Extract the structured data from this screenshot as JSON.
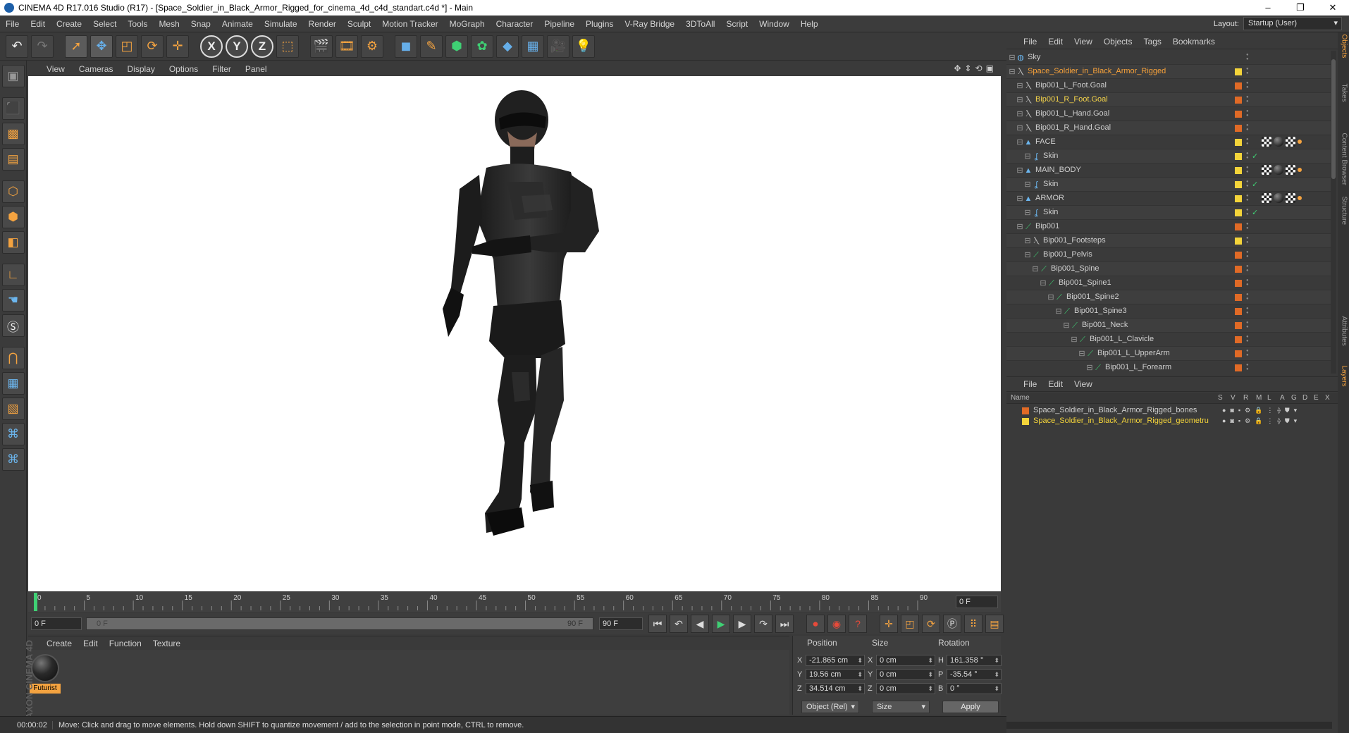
{
  "window": {
    "title": "CINEMA 4D R17.016 Studio (R17) - [Space_Soldier_in_Black_Armor_Rigged_for_cinema_4d_c4d_standart.c4d *] - Main",
    "controls": [
      "–",
      "❐",
      "✕"
    ]
  },
  "menubar": {
    "items": [
      "File",
      "Edit",
      "Create",
      "Select",
      "Tools",
      "Mesh",
      "Snap",
      "Animate",
      "Simulate",
      "Render",
      "Sculpt",
      "Motion Tracker",
      "MoGraph",
      "Character",
      "Pipeline",
      "Plugins",
      "V-Ray Bridge",
      "3DToAll",
      "Script",
      "Window",
      "Help"
    ],
    "layout_label": "Layout:",
    "layout_value": "Startup (User)"
  },
  "toolbar": {
    "axis_x": "X",
    "axis_y": "Y",
    "axis_z": "Z",
    "icons": [
      "undo-icon",
      "redo-icon",
      "live-selection-icon",
      "move-icon",
      "scale-icon",
      "rotate-icon",
      "last-tool-icon",
      "x-axis-icon",
      "y-axis-icon",
      "z-axis-icon",
      "coordinate-system-icon",
      "render-view-icon",
      "render-picture-viewer-icon",
      "render-settings-icon",
      "cube-icon",
      "pen-icon",
      "subdivision-icon",
      "cloner-icon",
      "deformer-icon",
      "floor-icon",
      "camera-icon",
      "light-icon"
    ]
  },
  "viewport": {
    "menu": [
      "View",
      "Cameras",
      "Display",
      "Options",
      "Filter",
      "Panel"
    ],
    "background": "#ffffff"
  },
  "timeline": {
    "ticks": [
      "0",
      "5",
      "10",
      "15",
      "20",
      "25",
      "30",
      "35",
      "40",
      "45",
      "50",
      "55",
      "60",
      "65",
      "70",
      "75",
      "80",
      "85",
      "90"
    ],
    "current_frame": "0 F",
    "start_field": "0 F",
    "slider_start": "0 F",
    "slider_end": "90 F",
    "end_field": "90 F"
  },
  "materials": {
    "menu": [
      "Create",
      "Edit",
      "Function",
      "Texture"
    ],
    "items": [
      {
        "name": "Futurist"
      }
    ]
  },
  "coordinates": {
    "headers": {
      "position": "Position",
      "size": "Size",
      "rotation": "Rotation"
    },
    "rows": [
      {
        "axis": "X",
        "pos": "-21.865 cm",
        "size_axis": "X",
        "size": "0 cm",
        "rot_axis": "H",
        "rot": "161.358 °"
      },
      {
        "axis": "Y",
        "pos": "19.56 cm",
        "size_axis": "Y",
        "size": "0 cm",
        "rot_axis": "P",
        "rot": "-35.54 °"
      },
      {
        "axis": "Z",
        "pos": "34.514 cm",
        "size_axis": "Z",
        "size": "0 cm",
        "rot_axis": "B",
        "rot": "0 °"
      }
    ],
    "mode": "Object (Rel)",
    "size_mode": "Size",
    "apply": "Apply"
  },
  "statusbar": {
    "time": "00:00:02",
    "message": "Move: Click and drag to move elements. Hold down SHIFT to quantize movement / add to the selection in point mode, CTRL to remove."
  },
  "object_manager": {
    "menu": [
      "File",
      "Edit",
      "View",
      "Objects",
      "Tags",
      "Bookmarks"
    ],
    "objects": [
      {
        "name": "Sky",
        "indent": 0,
        "icon": "sky-icon",
        "style": "normal",
        "tag": "none",
        "check": false,
        "mats": false
      },
      {
        "name": "Space_Soldier_in_Black_Armor_Rigged",
        "indent": 0,
        "icon": "null-icon",
        "style": "sel",
        "tag": "yellow",
        "check": false,
        "mats": false
      },
      {
        "name": "Bip001_L_Foot.Goal",
        "indent": 1,
        "icon": "null-icon",
        "style": "normal",
        "tag": "orange",
        "check": false,
        "mats": false
      },
      {
        "name": "Bip001_R_Foot.Goal",
        "indent": 1,
        "icon": "null-icon",
        "style": "yellow",
        "tag": "orange",
        "check": false,
        "mats": false
      },
      {
        "name": "Bip001_L_Hand.Goal",
        "indent": 1,
        "icon": "null-icon",
        "style": "normal",
        "tag": "orange",
        "check": false,
        "mats": false
      },
      {
        "name": "Bip001_R_Hand.Goal",
        "indent": 1,
        "icon": "null-icon",
        "style": "normal",
        "tag": "orange",
        "check": false,
        "mats": false
      },
      {
        "name": "FACE",
        "indent": 1,
        "icon": "mesh-icon",
        "style": "normal",
        "tag": "yellow",
        "check": false,
        "mats": true
      },
      {
        "name": "Skin",
        "indent": 2,
        "icon": "skin-icon",
        "style": "normal",
        "tag": "yellow",
        "check": true,
        "mats": false
      },
      {
        "name": "MAIN_BODY",
        "indent": 1,
        "icon": "mesh-icon",
        "style": "normal",
        "tag": "yellow",
        "check": false,
        "mats": true
      },
      {
        "name": "Skin",
        "indent": 2,
        "icon": "skin-icon",
        "style": "normal",
        "tag": "yellow",
        "check": true,
        "mats": false
      },
      {
        "name": "ARMOR",
        "indent": 1,
        "icon": "mesh-icon",
        "style": "normal",
        "tag": "yellow",
        "check": false,
        "mats": true
      },
      {
        "name": "Skin",
        "indent": 2,
        "icon": "skin-icon",
        "style": "normal",
        "tag": "yellow",
        "check": true,
        "mats": false
      },
      {
        "name": "Bip001",
        "indent": 1,
        "icon": "bone-icon",
        "style": "normal",
        "tag": "orange",
        "check": false,
        "mats": false
      },
      {
        "name": "Bip001_Footsteps",
        "indent": 2,
        "icon": "null-icon",
        "style": "normal",
        "tag": "yellow",
        "check": false,
        "mats": false
      },
      {
        "name": "Bip001_Pelvis",
        "indent": 2,
        "icon": "bone-icon",
        "style": "normal",
        "tag": "orange",
        "check": false,
        "mats": false
      },
      {
        "name": "Bip001_Spine",
        "indent": 3,
        "icon": "bone-icon",
        "style": "normal",
        "tag": "orange",
        "check": false,
        "mats": false
      },
      {
        "name": "Bip001_Spine1",
        "indent": 4,
        "icon": "bone-icon",
        "style": "normal",
        "tag": "orange",
        "check": false,
        "mats": false
      },
      {
        "name": "Bip001_Spine2",
        "indent": 5,
        "icon": "bone-icon",
        "style": "normal",
        "tag": "orange",
        "check": false,
        "mats": false
      },
      {
        "name": "Bip001_Spine3",
        "indent": 6,
        "icon": "bone-icon",
        "style": "normal",
        "tag": "orange",
        "check": false,
        "mats": false
      },
      {
        "name": "Bip001_Neck",
        "indent": 7,
        "icon": "bone-icon",
        "style": "normal",
        "tag": "orange",
        "check": false,
        "mats": false
      },
      {
        "name": "Bip001_L_Clavicle",
        "indent": 8,
        "icon": "bone-icon",
        "style": "normal",
        "tag": "orange",
        "check": false,
        "mats": false
      },
      {
        "name": "Bip001_L_UpperArm",
        "indent": 9,
        "icon": "bone-icon",
        "style": "normal",
        "tag": "orange",
        "check": false,
        "mats": false
      },
      {
        "name": "Bip001_L_Forearm",
        "indent": 10,
        "icon": "bone-icon",
        "style": "normal",
        "tag": "orange",
        "check": false,
        "mats": false
      }
    ]
  },
  "layer_manager": {
    "menu": [
      "File",
      "Edit",
      "View"
    ],
    "columns": [
      "Name",
      "S",
      "V",
      "R",
      "M",
      "L",
      "A",
      "G",
      "D",
      "E",
      "X"
    ],
    "layers": [
      {
        "name": "Space_Soldier_in_Black_Armor_Rigged_bones",
        "color": "#e06a26",
        "selected": false
      },
      {
        "name": "Space_Soldier_in_Black_Armor_Rigged_geometru",
        "color": "#f4d43a",
        "selected": true
      }
    ]
  },
  "side_tabs": [
    "Objects",
    "Takes",
    "Content Browser",
    "Structure",
    "Attributes",
    "Layers"
  ],
  "colors": {
    "accent_orange": "#f4a340",
    "selected_text": "#f8a23a",
    "background": "#3a3a3a"
  }
}
